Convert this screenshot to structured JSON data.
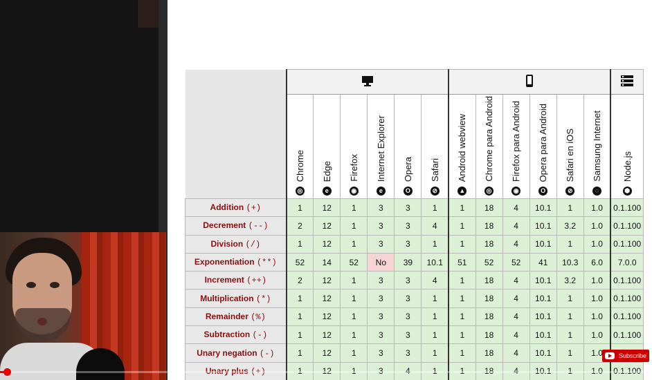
{
  "platforms": [
    {
      "icon": "desktop-icon",
      "span": 6
    },
    {
      "icon": "mobile-icon",
      "span": 6
    },
    {
      "icon": "server-icon",
      "span": 1
    }
  ],
  "browsers": [
    {
      "name": "Chrome",
      "icon": "chrome-icon",
      "glyph": "◎"
    },
    {
      "name": "Edge",
      "icon": "edge-icon",
      "glyph": "e"
    },
    {
      "name": "Firefox",
      "icon": "firefox-icon",
      "glyph": "◉"
    },
    {
      "name": "Internet Explorer",
      "icon": "ie-icon",
      "glyph": "e"
    },
    {
      "name": "Opera",
      "icon": "opera-icon",
      "glyph": "O"
    },
    {
      "name": "Safari",
      "icon": "safari-icon",
      "glyph": "⊘"
    },
    {
      "name": "Android webview",
      "icon": "android-icon",
      "glyph": "▲"
    },
    {
      "name": "Chrome para Android",
      "icon": "chrome-icon",
      "glyph": "◎"
    },
    {
      "name": "Firefox para Android",
      "icon": "firefox-icon",
      "glyph": "◉"
    },
    {
      "name": "Opera para Android",
      "icon": "opera-icon",
      "glyph": "O"
    },
    {
      "name": "Safari en iOS",
      "icon": "safari-icon",
      "glyph": "⊘"
    },
    {
      "name": "Samsung Internet",
      "icon": "samsung-icon",
      "glyph": "◌"
    },
    {
      "name": "Node.js",
      "icon": "nodejs-icon",
      "glyph": "⬢"
    }
  ],
  "rows": [
    {
      "feature": "Addition",
      "op": "(+)",
      "values": [
        "1",
        "12",
        "1",
        "3",
        "3",
        "1",
        "1",
        "18",
        "4",
        "10.1",
        "1",
        "1.0",
        "0.1.100"
      ]
    },
    {
      "feature": "Decrement",
      "op": "(--)",
      "values": [
        "2",
        "12",
        "1",
        "3",
        "3",
        "4",
        "1",
        "18",
        "4",
        "10.1",
        "3.2",
        "1.0",
        "0.1.100"
      ]
    },
    {
      "feature": "Division",
      "op": "(/)",
      "values": [
        "1",
        "12",
        "1",
        "3",
        "3",
        "1",
        "1",
        "18",
        "4",
        "10.1",
        "1",
        "1.0",
        "0.1.100"
      ]
    },
    {
      "feature": "Exponentiation",
      "op": "(**)",
      "values": [
        "52",
        "14",
        "52",
        "No",
        "39",
        "10.1",
        "51",
        "52",
        "52",
        "41",
        "10.3",
        "6.0",
        "7.0.0"
      ]
    },
    {
      "feature": "Increment",
      "op": "(++)",
      "values": [
        "2",
        "12",
        "1",
        "3",
        "3",
        "4",
        "1",
        "18",
        "4",
        "10.1",
        "3.2",
        "1.0",
        "0.1.100"
      ]
    },
    {
      "feature": "Multiplication",
      "op": "(*)",
      "values": [
        "1",
        "12",
        "1",
        "3",
        "3",
        "1",
        "1",
        "18",
        "4",
        "10.1",
        "1",
        "1.0",
        "0.1.100"
      ]
    },
    {
      "feature": "Remainder",
      "op": "(%)",
      "values": [
        "1",
        "12",
        "1",
        "3",
        "3",
        "1",
        "1",
        "18",
        "4",
        "10.1",
        "1",
        "1.0",
        "0.1.100"
      ]
    },
    {
      "feature": "Subtraction",
      "op": "(-)",
      "values": [
        "1",
        "12",
        "1",
        "3",
        "3",
        "1",
        "1",
        "18",
        "4",
        "10.1",
        "1",
        "1.0",
        "0.1.100"
      ]
    },
    {
      "feature": "Unary negation",
      "op": "(-)",
      "values": [
        "1",
        "12",
        "1",
        "3",
        "3",
        "1",
        "1",
        "18",
        "4",
        "10.1",
        "1",
        "1.0",
        "0.1.100"
      ]
    },
    {
      "feature": "Unary plus",
      "op": "(+)",
      "values": [
        "1",
        "12",
        "1",
        "3",
        "4",
        "1",
        "1",
        "18",
        "4",
        "10.1",
        "1",
        "1.0",
        "0.1.100"
      ]
    }
  ],
  "player": {
    "subscribe_label": "Subscribe",
    "progress": 0.006,
    "accent": "#e00000"
  },
  "colors": {
    "supported": "#dcf0d6",
    "unsupported": "#f7d3d3",
    "feature_text": "#8b0e0e"
  }
}
